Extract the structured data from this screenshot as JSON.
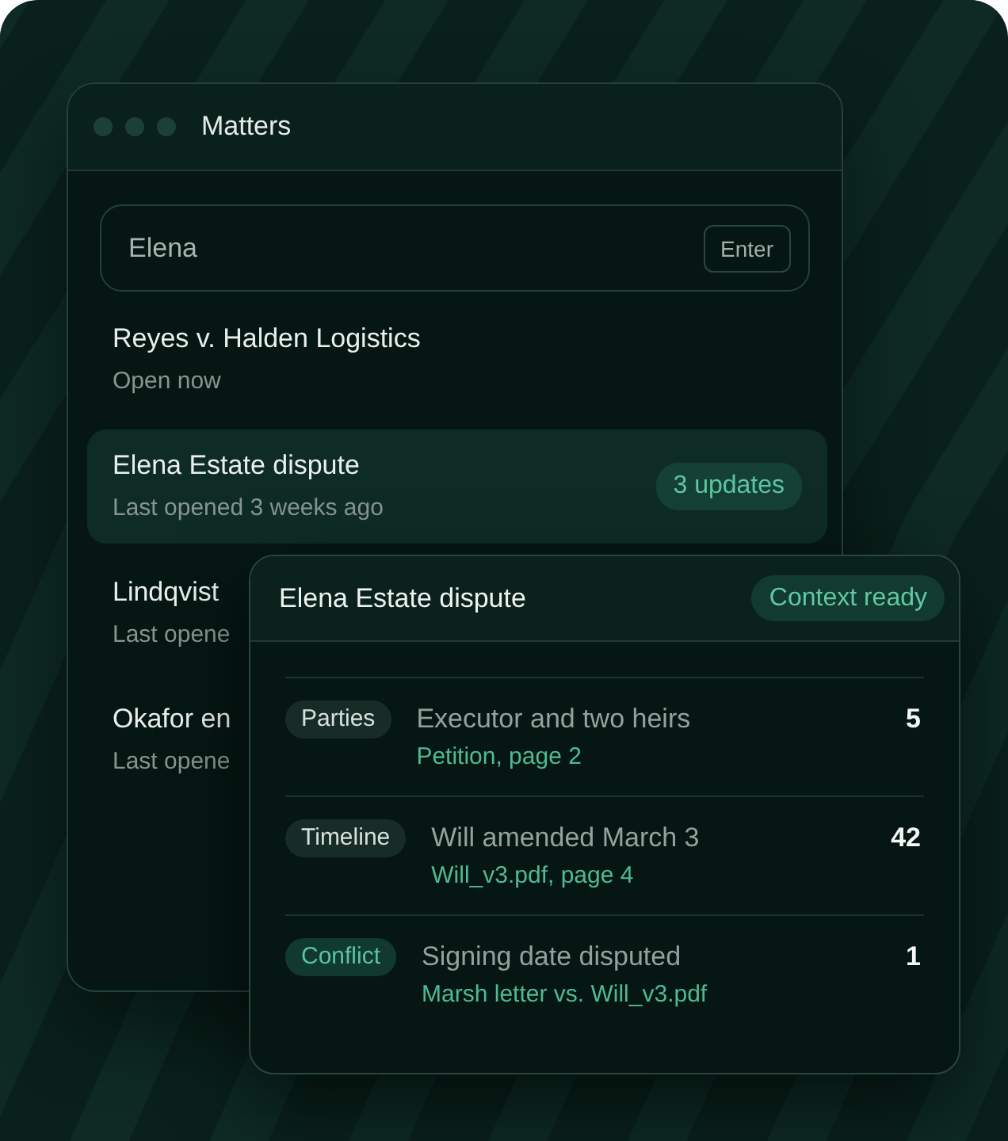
{
  "window": {
    "title": "Matters"
  },
  "search": {
    "value": "Elena",
    "key_hint": "Enter"
  },
  "matters": [
    {
      "title": "Reyes v. Halden Logistics",
      "subtitle": "Open now",
      "selected": false
    },
    {
      "title": "Elena Estate dispute",
      "subtitle": "Last opened 3 weeks ago",
      "badge": "3 updates",
      "selected": true
    },
    {
      "title": "Lindqvist",
      "subtitle": "Last opene",
      "selected": false
    },
    {
      "title": "Okafor en",
      "subtitle": "Last opene",
      "selected": false
    }
  ],
  "context_card": {
    "title": "Elena Estate dispute",
    "status": "Context ready",
    "facts": [
      {
        "tag": "Parties",
        "flagged": false,
        "summary": "Executor and two heirs",
        "source": "Petition, page 2",
        "count": "5"
      },
      {
        "tag": "Timeline",
        "flagged": false,
        "summary": "Will amended March 3",
        "source": "Will_v3.pdf, page 4",
        "count": "42"
      },
      {
        "tag": "Conflict",
        "flagged": true,
        "summary": "Signing date disputed",
        "source": "Marsh letter vs. Will_v3.pdf",
        "count": "1"
      }
    ]
  }
}
